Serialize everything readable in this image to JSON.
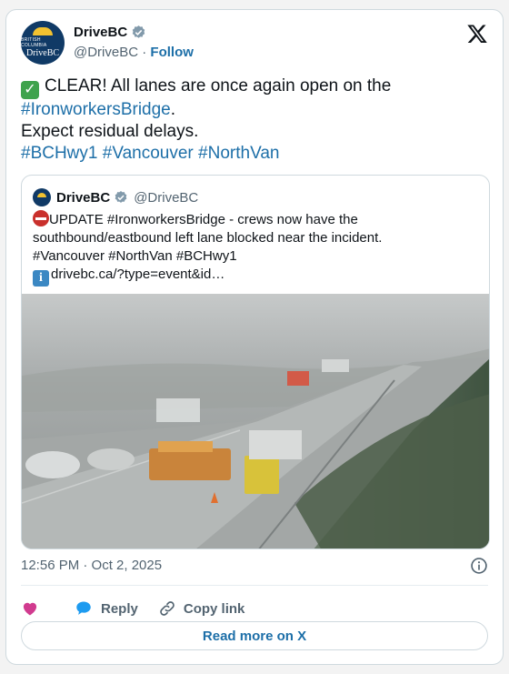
{
  "author": {
    "name": "DriveBC",
    "handle": "@DriveBC",
    "separator": "·",
    "follow_label": "Follow",
    "avatar_text_small": "BRITISH COLUMBIA",
    "avatar_logo_text": "DriveBC"
  },
  "tweet": {
    "line1_text": "CLEAR! All lanes are once again open on the",
    "line2_link": "#IronworkersBridge",
    "line2_suffix": ".",
    "line3_text": "Expect residual delays.",
    "hashtags": [
      "#BCHwy1",
      "#Vancouver",
      "#NorthVan"
    ],
    "check_glyph": "✓"
  },
  "quoted": {
    "name": "DriveBC",
    "handle": "@DriveBC",
    "line1": "UPDATE #IronworkersBridge - crews now have the",
    "line2": "southbound/eastbound left lane blocked near the incident.",
    "line3": "#Vancouver #NorthVan #BCHwy1",
    "link_text": "drivebc.ca/?type=event&id…",
    "info_glyph": "i"
  },
  "timestamp": "12:56 PM · Oct 2, 2025",
  "actions": {
    "reply_label": "Reply",
    "copy_link_label": "Copy link"
  },
  "read_more_label": "Read more on X",
  "colors": {
    "link": "#1d6fa8",
    "heart": "#d13b8f",
    "reply_bubble": "#1d9bf0",
    "verified": "#829aab"
  },
  "icons": {
    "verified": "verified-badge-icon",
    "x_logo": "x-logo-icon",
    "info": "info-icon",
    "heart": "heart-icon",
    "reply": "reply-bubble-icon",
    "copy_link": "link-icon"
  }
}
